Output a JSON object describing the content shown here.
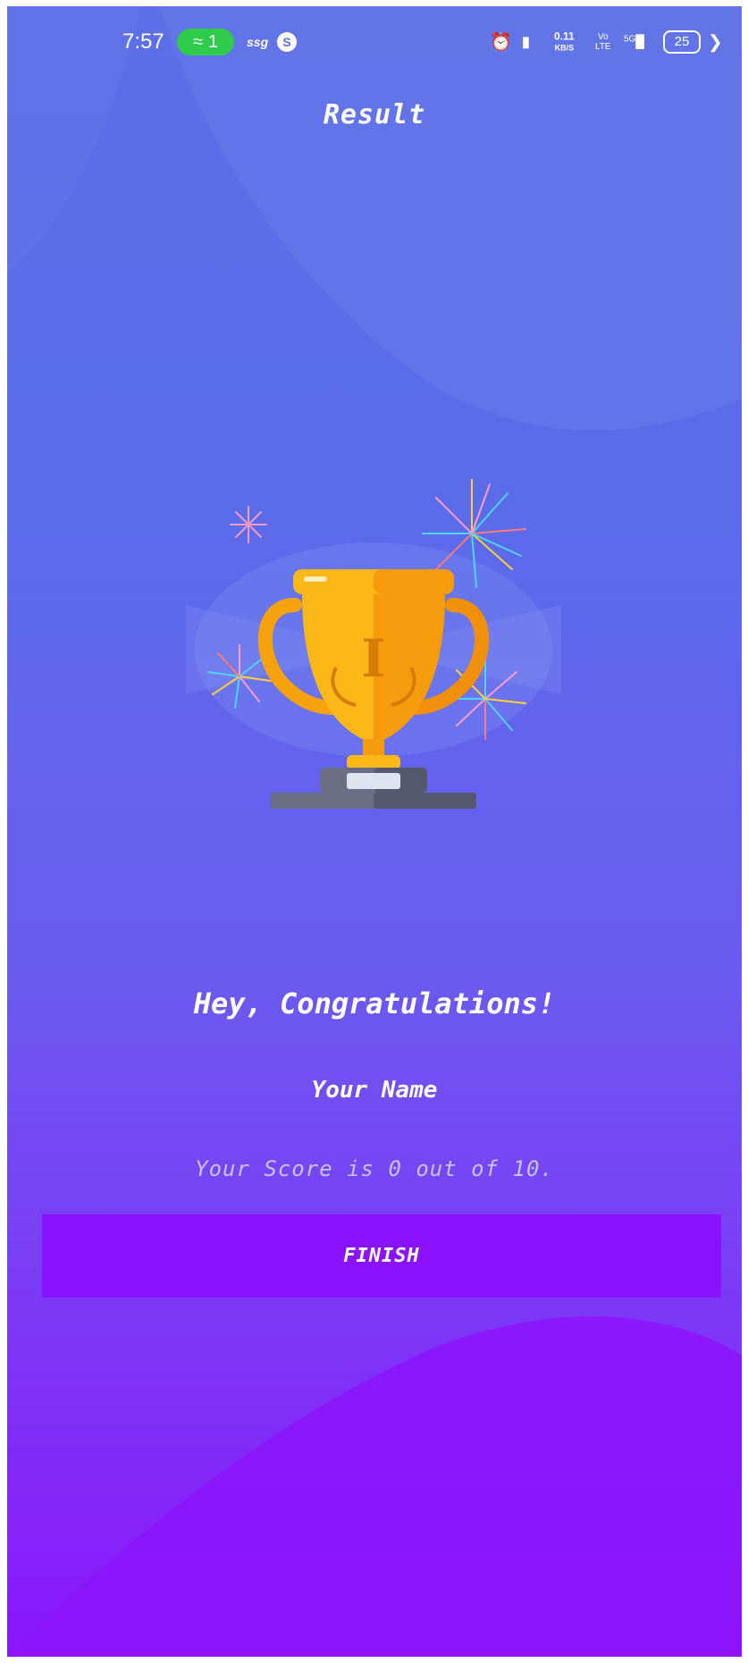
{
  "status_bar": {
    "time": "7:57",
    "hotspot_count": "1",
    "ssg": "ssg",
    "s_icon": "S",
    "speed_value": "0.11",
    "speed_unit": "KB/S",
    "volte_top": "Vo",
    "volte_bottom": "LTE",
    "network": "5G",
    "battery": "25",
    "icons": [
      "hotspot-icon",
      "s-icon",
      "alarm-icon",
      "vibrate-icon",
      "signal-icon",
      "battery-icon",
      "charging-icon"
    ]
  },
  "header": {
    "title": "Result"
  },
  "illustration": {
    "name": "trophy-with-fireworks",
    "trophy_mark": "I"
  },
  "main": {
    "congrats": "Hey, Congratulations!",
    "player_name": "Your Name",
    "score": "Your Score is 0 out of 10.",
    "finish_label": "FINISH"
  },
  "colors": {
    "background_top": "#5c6fe6",
    "background_bottom": "#8a17fb",
    "button": "#8a12fc",
    "trophy_gold": "#fcb819",
    "trophy_orange": "#f59b0c",
    "hotspot_badge": "#2ecc4a"
  }
}
